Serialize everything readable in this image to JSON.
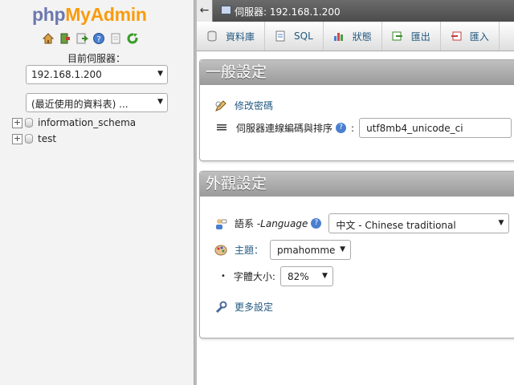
{
  "nav": {
    "logo_php": "php",
    "logo_myadmin": "MyAdmin",
    "icons": [
      "home-icon",
      "exit-icon",
      "query-icon",
      "help-icon",
      "docs-icon",
      "reload-icon"
    ],
    "server_label": "目前伺服器：",
    "server_value": "192.168.1.200",
    "recent_value": "(最近使用的資料表) ...",
    "databases": [
      "information_schema",
      "test"
    ]
  },
  "topbar": {
    "back_symbol": "←",
    "breadcrumb": "伺服器: 192.168.1.200"
  },
  "tabs": [
    {
      "label": "資料庫",
      "icon": "database-icon"
    },
    {
      "label": "SQL",
      "icon": "sql-icon"
    },
    {
      "label": "狀態",
      "icon": "status-icon"
    },
    {
      "label": "匯出",
      "icon": "export-icon"
    },
    {
      "label": "匯入",
      "icon": "import-icon"
    }
  ],
  "general": {
    "title": "一般設定",
    "change_password": "修改密碼",
    "collation_label": "伺服器連線編碼與排序",
    "collation_value": "utf8mb4_unicode_ci"
  },
  "appearance": {
    "title": "外觀設定",
    "language_label": "語系 - ",
    "language_label_en": "Language",
    "language_value": "中文 - Chinese traditional",
    "theme_label": "主題：",
    "theme_value": "pmahomme",
    "fontsize_label": "字體大小:",
    "fontsize_value": "82%",
    "more_settings": "更多設定"
  },
  "colors": {
    "link": "#235a81",
    "logo_php": "#6c78af",
    "logo_myadmin": "#f89c0e",
    "panel_header": "#a8a8a8",
    "topbar": "#5a5a5a"
  }
}
